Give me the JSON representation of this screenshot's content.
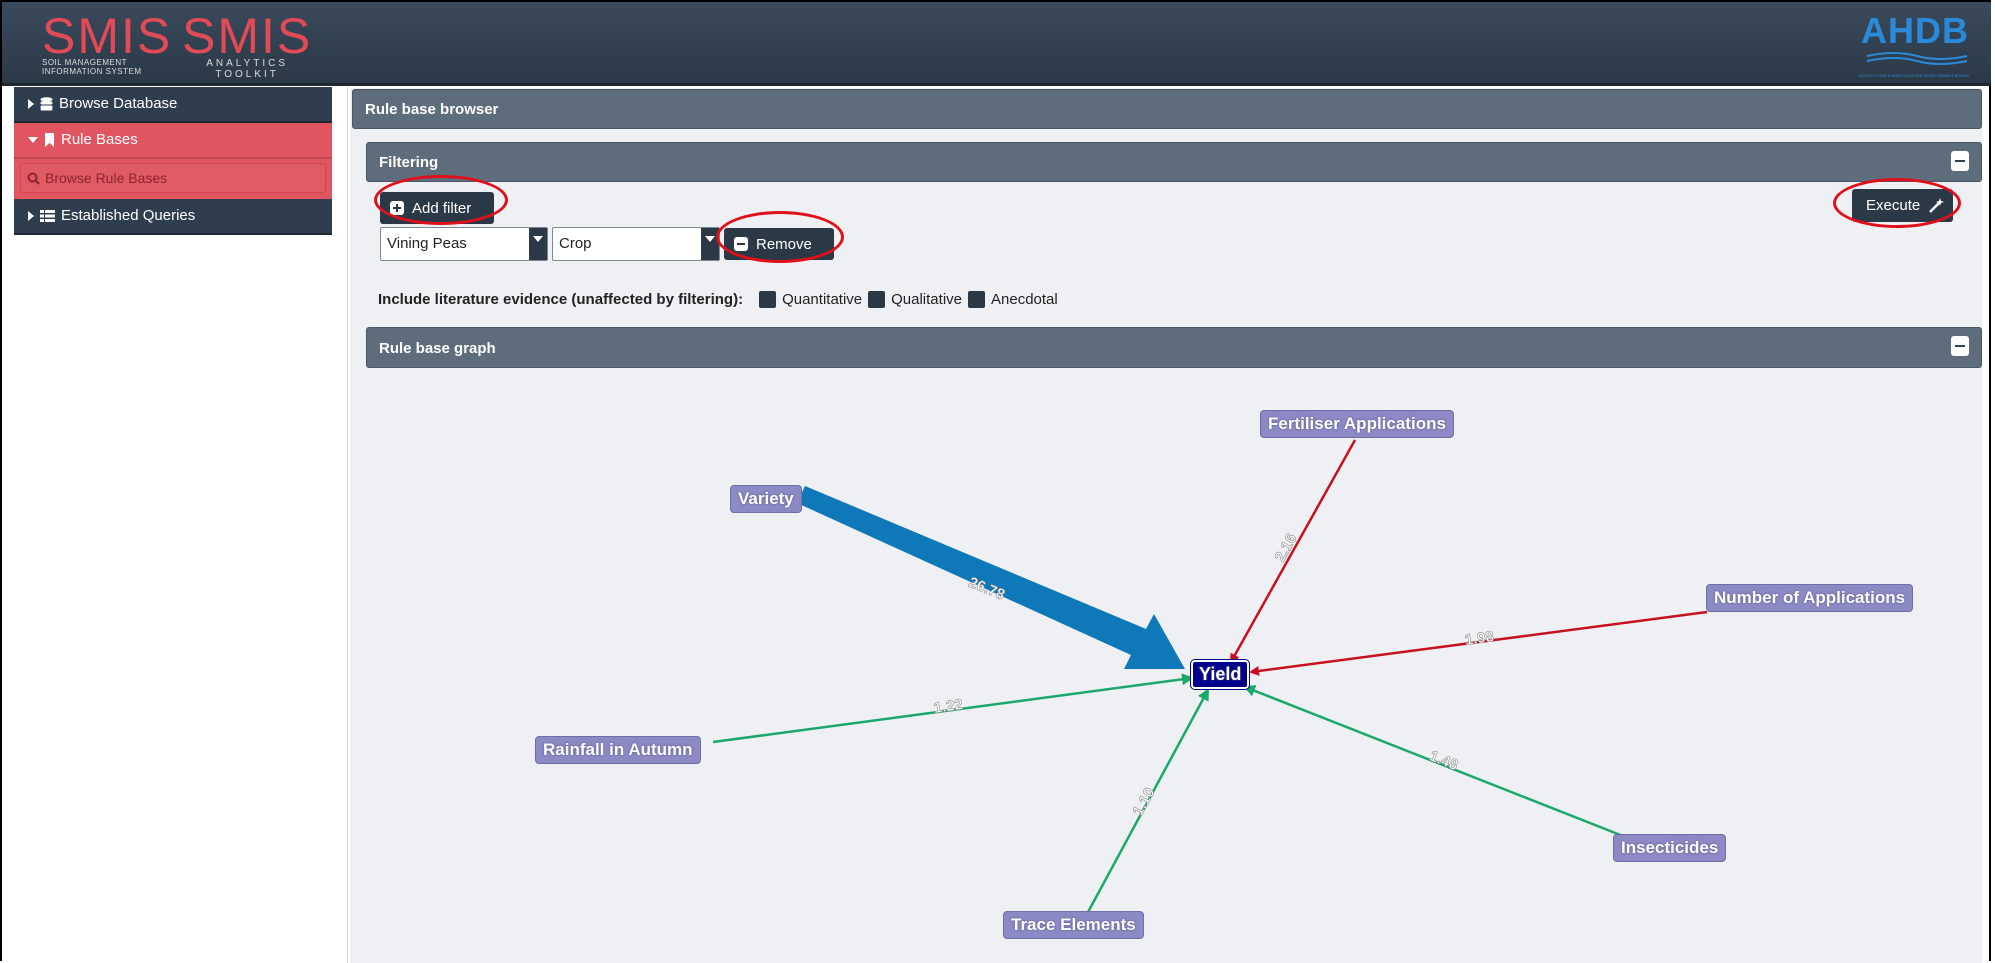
{
  "header": {
    "logo1_big": "SMIS",
    "logo1_line1": "SOIL MANAGEMENT",
    "logo1_line2": "INFORMATION SYSTEM",
    "logo2_big": "SMIS",
    "logo2_line1": "ANALYTICS",
    "logo2_line2": "TOOLKIT",
    "ahdb": "AHDB",
    "ahdb_sub": "AGRICULTURE & HORTICULTURE DEVELOPMENT BOARD"
  },
  "sidebar": {
    "items": [
      {
        "label": "Browse Database",
        "icon": "database-icon"
      },
      {
        "label": "Rule Bases",
        "icon": "bookmark-icon"
      },
      {
        "label": "Browse Rule Bases",
        "icon": "search-icon"
      },
      {
        "label": "Established Queries",
        "icon": "table-list-icon"
      }
    ]
  },
  "main": {
    "title": "Rule base browser",
    "filtering": {
      "title": "Filtering",
      "add_filter": "Add filter",
      "execute": "Execute",
      "remove": "Remove",
      "select1_value": "Vining Peas",
      "select2_value": "Crop",
      "evidence_label": "Include literature evidence (unaffected by filtering):",
      "evidence_options": [
        "Quantitative",
        "Qualitative",
        "Anecdotal"
      ]
    },
    "graph": {
      "title": "Rule base graph",
      "center": "Yield",
      "nodes": [
        {
          "label": "Fertiliser Applications",
          "weight": "2.16",
          "color": "#c8101e"
        },
        {
          "label": "Number of Applications",
          "weight": "1.98",
          "color": "#c8101e"
        },
        {
          "label": "Variety",
          "weight": "26.78",
          "color": "#0e78b8"
        },
        {
          "label": "Rainfall in Autumn",
          "weight": "1.22",
          "color": "#1aa86b"
        },
        {
          "label": "Trace Elements",
          "weight": "1.10",
          "color": "#1aa86b"
        },
        {
          "label": "Insecticides",
          "weight": "1.48",
          "color": "#1aa86b"
        }
      ]
    }
  },
  "colors": {
    "accent": "#e05560",
    "dark": "#2b3947",
    "panel": "#5d6d7b"
  }
}
